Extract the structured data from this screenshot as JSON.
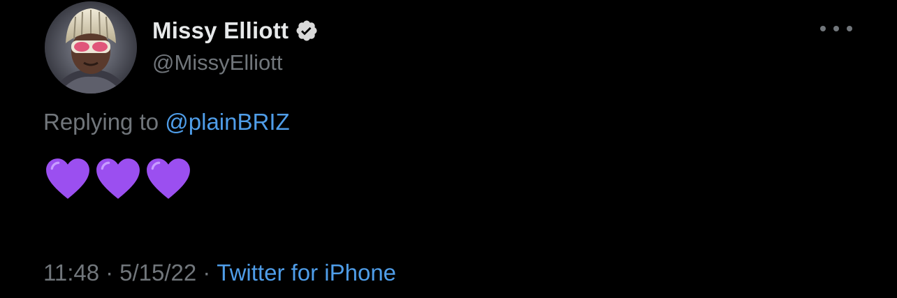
{
  "tweet": {
    "author": {
      "display_name": "Missy Elliott",
      "handle": "@MissyElliott",
      "verified": true
    },
    "reply_prefix": "Replying to ",
    "reply_to": "@plainBRIZ",
    "content_emojis": [
      "purple-heart",
      "purple-heart",
      "purple-heart"
    ],
    "time": "11:48",
    "separator": "·",
    "date": "5/15/22",
    "source": "Twitter for iPhone"
  },
  "colors": {
    "background": "#000000",
    "primary_text": "#e7e9ea",
    "secondary_text": "#71767b",
    "link": "#4f9de8",
    "heart": "#a855f7"
  },
  "icons": {
    "verified": "verified-badge-icon",
    "more": "more-options-icon",
    "heart": "purple-heart-icon"
  }
}
